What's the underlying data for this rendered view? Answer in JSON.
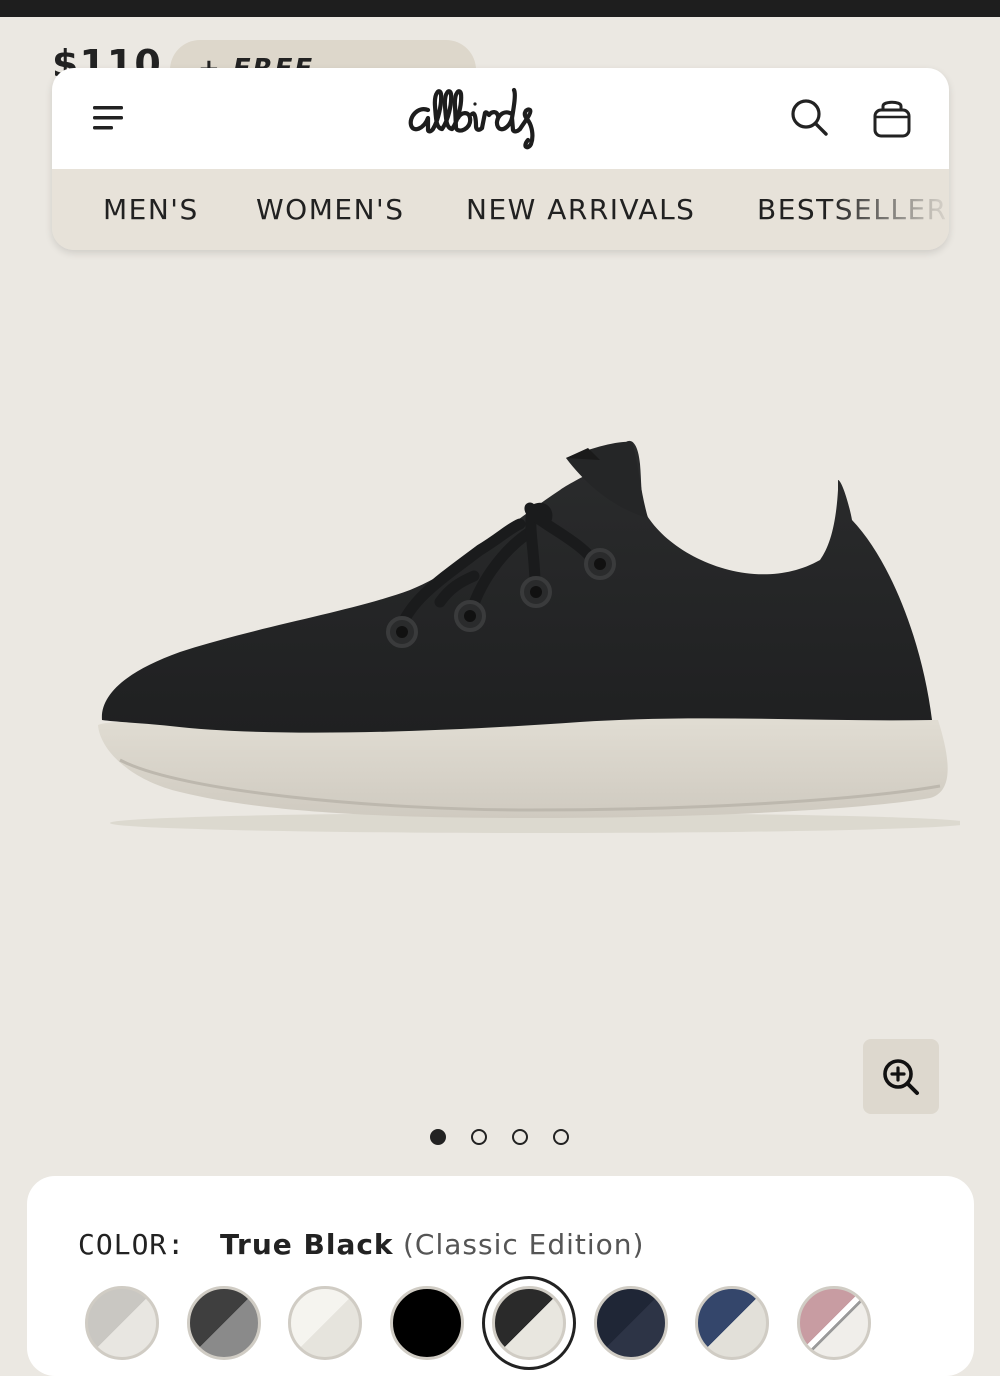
{
  "peek": {
    "price": "$110",
    "shipping": "+ FREE SHIPPING"
  },
  "header": {
    "logo": "allbirds",
    "nav": [
      "MEN'S",
      "WOMEN'S",
      "NEW ARRIVALS",
      "BESTSELLER"
    ]
  },
  "icons": {
    "menu": "menu-icon",
    "search": "search-icon",
    "cart": "cart-icon",
    "zoom": "zoom-in-icon"
  },
  "gallery": {
    "total_images": 4,
    "active_index": 0
  },
  "color": {
    "label": "COLOR:",
    "name": "True Black",
    "edition": "(Classic Edition)",
    "swatches": [
      {
        "a": "#c9c7c2",
        "b": "#e8e6e1"
      },
      {
        "a": "#3f3f3f",
        "b": "#8a8a8a"
      },
      {
        "a": "#f5f4ef",
        "b": "#e6e4dd"
      },
      {
        "a": "#000000",
        "b": "#000000"
      },
      {
        "a": "#2a2a2a",
        "b": "#e8e6df",
        "selected": true
      },
      {
        "a": "#1f2636",
        "b": "#2d3446"
      },
      {
        "a": "#34466b",
        "b": "#e2e0d9"
      },
      {
        "a": "#c89ca2",
        "b": "#f0eeea",
        "striped": true
      }
    ]
  },
  "colors": {
    "background": "#ebe8e2",
    "nav_bar": "#e7e2d9",
    "text": "#212121"
  }
}
